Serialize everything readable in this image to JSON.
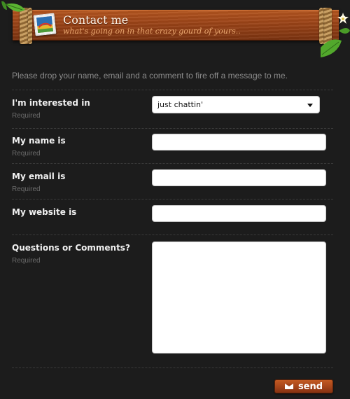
{
  "header": {
    "title": "Contact me",
    "subtitle": "what's going on in that crazy gourd of yours.."
  },
  "intro": "Please drop your name, email and a comment to fire off a message to me.",
  "form": {
    "interest": {
      "label": "I'm interested in",
      "required": "Required",
      "selected": "just chattin'"
    },
    "name": {
      "label": "My name is",
      "required": "Required",
      "value": ""
    },
    "email": {
      "label": "My email is",
      "required": "Required",
      "value": ""
    },
    "website": {
      "label": "My website is",
      "value": ""
    },
    "comments": {
      "label": "Questions or Comments?",
      "required": "Required",
      "value": ""
    }
  },
  "send_button": {
    "label": "send",
    "icon": "envelope-icon"
  },
  "colors": {
    "background": "#1c1c1c",
    "banner": "#9a4317",
    "leaf": "#4fa12a",
    "button": "#a4441a"
  }
}
